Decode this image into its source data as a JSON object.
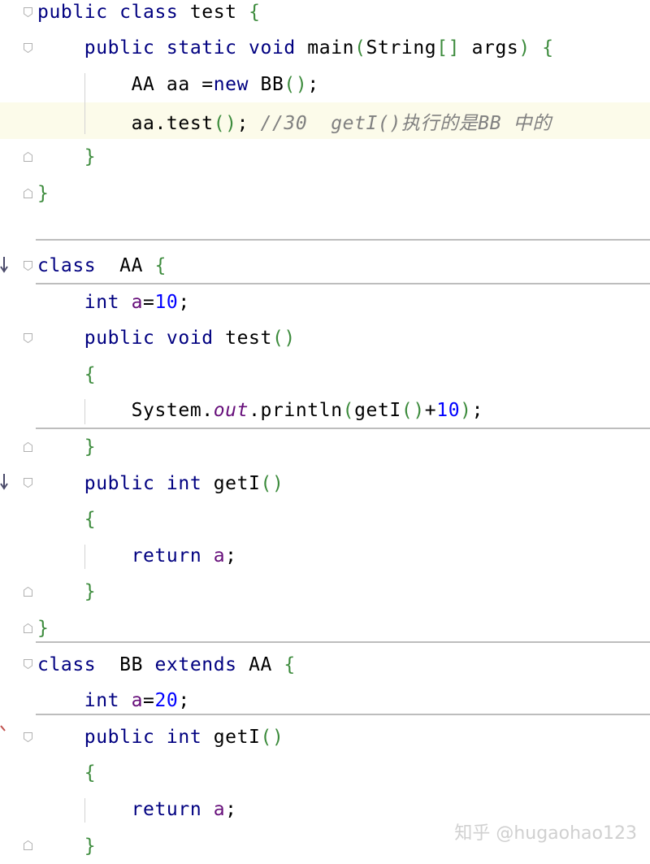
{
  "editor": {
    "lines": [
      {
        "tokens": [
          [
            "kw",
            "public class "
          ],
          [
            "id",
            "test "
          ],
          [
            "br",
            "{"
          ]
        ]
      },
      {
        "tokens": [
          [
            "kw",
            "    public static void "
          ],
          [
            "id",
            "main"
          ],
          [
            "br",
            "("
          ],
          [
            "id",
            "String"
          ],
          [
            "br",
            "[]"
          ],
          [
            "id",
            " args"
          ],
          [
            "br",
            ") "
          ],
          [
            "br",
            "{"
          ]
        ]
      },
      {
        "tokens": [
          [
            "id",
            "        AA aa "
          ],
          [
            "pun",
            "="
          ],
          [
            "kw",
            "new "
          ],
          [
            "id",
            "BB"
          ],
          [
            "br",
            "()"
          ],
          [
            "pun",
            ";"
          ]
        ]
      },
      {
        "tokens": [
          [
            "id",
            "        aa.test"
          ],
          [
            "br",
            "()"
          ],
          [
            "pun",
            "; "
          ],
          [
            "cmt",
            "//30  getI()执行的是BB 中的"
          ]
        ]
      },
      {
        "tokens": [
          [
            "br",
            "    }"
          ]
        ]
      },
      {
        "tokens": [
          [
            "br",
            "}"
          ]
        ]
      },
      {
        "tokens": []
      },
      {
        "tokens": [
          [
            "kw",
            "class  "
          ],
          [
            "id",
            "AA "
          ],
          [
            "br",
            "{"
          ]
        ]
      },
      {
        "tokens": [
          [
            "kw",
            "    int "
          ],
          [
            "fld",
            "a"
          ],
          [
            "pun",
            "="
          ],
          [
            "num",
            "10"
          ],
          [
            "pun",
            ";"
          ]
        ]
      },
      {
        "tokens": [
          [
            "kw",
            "    public void "
          ],
          [
            "id",
            "test"
          ],
          [
            "br",
            "()"
          ]
        ]
      },
      {
        "tokens": [
          [
            "br",
            "    {"
          ]
        ]
      },
      {
        "tokens": [
          [
            "id",
            "        System."
          ],
          [
            "sfld",
            "out"
          ],
          [
            "id",
            ".println"
          ],
          [
            "br",
            "("
          ],
          [
            "id",
            "getI"
          ],
          [
            "br",
            "()"
          ],
          [
            "pun",
            "+"
          ],
          [
            "num",
            "10"
          ],
          [
            "br",
            ")"
          ],
          [
            "pun",
            ";"
          ]
        ]
      },
      {
        "tokens": [
          [
            "br",
            "    }"
          ]
        ]
      },
      {
        "tokens": [
          [
            "kw",
            "    public int "
          ],
          [
            "id",
            "getI"
          ],
          [
            "br",
            "()"
          ]
        ]
      },
      {
        "tokens": [
          [
            "br",
            "    {"
          ]
        ]
      },
      {
        "tokens": [
          [
            "kw",
            "        return "
          ],
          [
            "fld",
            "a"
          ],
          [
            "pun",
            ";"
          ]
        ]
      },
      {
        "tokens": [
          [
            "br",
            "    }"
          ]
        ]
      },
      {
        "tokens": [
          [
            "br",
            "}"
          ]
        ]
      },
      {
        "tokens": [
          [
            "kw",
            "class  "
          ],
          [
            "id",
            "BB "
          ],
          [
            "kw",
            "extends "
          ],
          [
            "id",
            "AA "
          ],
          [
            "br",
            "{"
          ]
        ]
      },
      {
        "tokens": [
          [
            "kw",
            "    int "
          ],
          [
            "fld",
            "a"
          ],
          [
            "pun",
            "="
          ],
          [
            "num",
            "20"
          ],
          [
            "pun",
            ";"
          ]
        ]
      },
      {
        "tokens": [
          [
            "kw",
            "    public int "
          ],
          [
            "id",
            "getI"
          ],
          [
            "br",
            "()"
          ]
        ]
      },
      {
        "tokens": [
          [
            "br",
            "    {"
          ]
        ]
      },
      {
        "tokens": [
          [
            "kw",
            "        return "
          ],
          [
            "fld",
            "a"
          ],
          [
            "pun",
            ";"
          ]
        ]
      },
      {
        "tokens": [
          [
            "br",
            "    }"
          ]
        ]
      }
    ],
    "highlighted_line_index": 3,
    "watermark": "知乎 @hugaohao123"
  },
  "colors": {
    "keyword": "#000080",
    "brace": "#3c8b3c",
    "number": "#0000ff",
    "field": "#660e7a",
    "comment": "#808080",
    "highlight_line": "#fcfbea",
    "separator": "#bdbdbd"
  }
}
